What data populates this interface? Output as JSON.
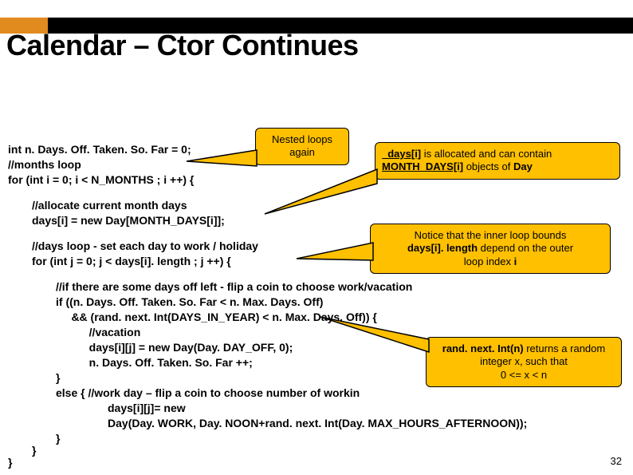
{
  "title": "Calendar – Ctor Continues",
  "code": {
    "l1": "int n. Days. Off. Taken. So. Far = 0;",
    "l2": "//months loop",
    "l3": "for (int i = 0; i < N_MONTHS ; i ++) {",
    "l4": "//allocate current month days",
    "l5": "days[i] = new Day[MONTH_DAYS[i]];",
    "l6": "//days loop - set each day to work / holiday",
    "l7": "for (int j = 0; j < days[i]. length ; j ++) {",
    "l8": "//if there are some days off left - flip a coin to choose work/vacation",
    "l9": "if ((n. Days. Off. Taken. So. Far < n. Max. Days. Off)",
    "l10": "     && (rand. next. Int(DAYS_IN_YEAR) < n. Max. Days. Off)) {",
    "l11": "   //vacation",
    "l12": "   days[i][j] = new Day(Day. DAY_OFF, 0);",
    "l13": "   n. Days. Off. Taken. So. Far ++;",
    "l14": "}",
    "l15": "else { //work day – flip a coin to choose number of workin",
    "l16": "         days[i][j]= new",
    "l17": "         Day(Day. WORK, Day. NOON+rand. next. Int(Day. MAX_HOURS_AFTERNOON));",
    "l18": "}",
    "l19": "}",
    "l20": "}"
  },
  "callouts": {
    "nested": "Nested loops\nagain",
    "alloc_pre1": "_days[i]",
    "alloc_mid1": " is allocated and can contain ",
    "alloc_pre2": "MONTH_DAYS[i]",
    "alloc_mid2": " objects of ",
    "alloc_bold": "Day",
    "inner_l1": "Notice that the inner loop bounds",
    "inner_b1": "days[i]. length",
    "inner_l2": " depend on the outer",
    "inner_l3": "loop index ",
    "inner_b2": "i",
    "rand_l1_b": "rand. next. Int(n)",
    "rand_l1": " returns a random",
    "rand_l2": "integer x, such that",
    "rand_l3": "0 <= x < n"
  },
  "pagenum": "32"
}
